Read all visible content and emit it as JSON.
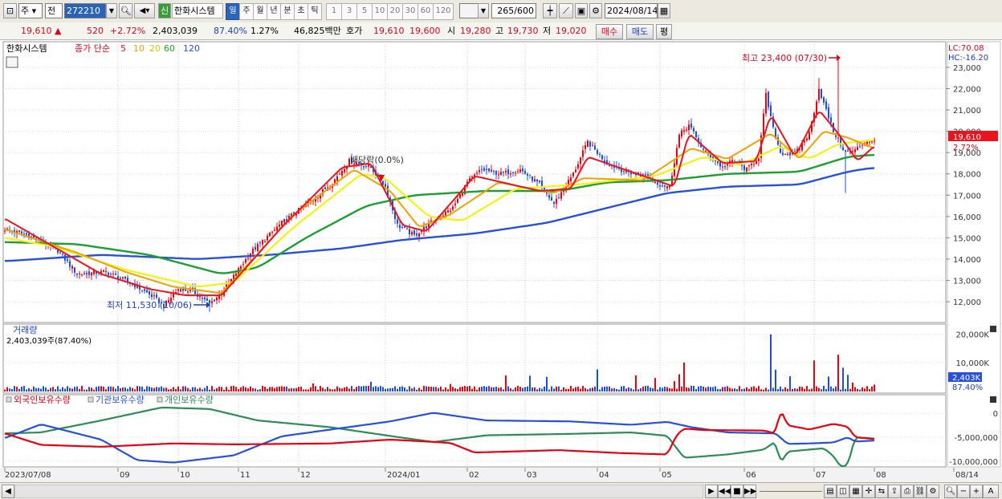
{
  "toolbar": {
    "market": "주",
    "prev": "전",
    "code": "272210",
    "shin_badge": "신",
    "stock_name": "한화시스템",
    "periods": [
      {
        "label": "일",
        "selected": true
      },
      {
        "label": "주",
        "selected": false
      },
      {
        "label": "월",
        "selected": false
      },
      {
        "label": "년",
        "selected": false
      },
      {
        "label": "분",
        "selected": false
      },
      {
        "label": "초",
        "selected": false
      },
      {
        "label": "틱",
        "selected": false
      },
      {
        "label": "1",
        "selected": false
      },
      {
        "label": "3",
        "selected": false
      },
      {
        "label": "5",
        "selected": false
      },
      {
        "label": "10",
        "selected": false
      },
      {
        "label": "20",
        "selected": false
      },
      {
        "label": "30",
        "selected": false
      },
      {
        "label": "60",
        "selected": false
      },
      {
        "label": "120",
        "selected": false
      }
    ],
    "count": "265",
    "count_total": "/600",
    "date": "2024/08/14"
  },
  "quote": {
    "price": "19,610",
    "change": "520",
    "change_pct": "+2.72%",
    "volume": "2,403,039",
    "vol_ratio": "87.40%",
    "turnover": "1.27%",
    "amount": "46,825백만",
    "hoga_label": "호가",
    "ask": "19,610",
    "bid": "19,600",
    "open_label": "시",
    "open": "19,280",
    "high_label": "고",
    "high": "19,730",
    "low_label": "저",
    "low": "19,020",
    "buy_btn": "매수",
    "sell_btn": "매도",
    "eval_btn": "평"
  },
  "legend": {
    "name": "한화시스템",
    "title": "종가 단순",
    "mas": [
      {
        "label": "5",
        "color": "#e8141e"
      },
      {
        "label": "10",
        "color": "#f0a000"
      },
      {
        "label": "20",
        "color": "#f2f214"
      },
      {
        "label": "60",
        "color": "#1e9e32"
      },
      {
        "label": "120",
        "color": "#2850d8"
      }
    ]
  },
  "colors": {
    "up": "#e60012",
    "down": "#1f4ed8",
    "ma5": "#e8141e",
    "ma10": "#f0a000",
    "ma20": "#f2f214",
    "ma60": "#1e9e32",
    "ma120": "#2850d8"
  },
  "annotations": {
    "high": "최고 23,400 (07/30)",
    "low": "최저 11,530 (10/06)",
    "dividend": "배당락(0.0%)"
  },
  "right_labels": {
    "lc": "LC:70.08",
    "hc": "HC:-16.20",
    "cur_price": "19,610",
    "cur_pct": "2.72%",
    "vol_now": "2,403K",
    "vol_pct": "87.40%"
  },
  "volume_panel": {
    "title": "거래량",
    "info": "2,403,039주(87.40%)"
  },
  "holdings_panel": {
    "legend": [
      "외국인보유수량",
      "기관보유수량",
      "개인보유수량"
    ],
    "colors": [
      "#e60012",
      "#2850d8",
      "#2e8b57"
    ]
  },
  "chart_data": {
    "type": "candlestick",
    "x_labels": [
      "2023/07/08",
      "09",
      "10",
      "11",
      "12",
      "2024/01",
      "02",
      "03",
      "04",
      "05",
      "06",
      "07",
      "08",
      "08/14"
    ],
    "price_axis": [
      12000,
      13000,
      14000,
      15000,
      16000,
      17000,
      18000,
      19000,
      20000,
      21000,
      22000,
      23000
    ],
    "price_axis_labels": [
      "12,000",
      "13,000",
      "14,000",
      "15,000",
      "16,000",
      "17,000",
      "18,000",
      "19,000",
      "20,000",
      "21,000",
      "22,000",
      "23,000"
    ],
    "price_range": [
      11100,
      23900
    ],
    "price_path": [
      [
        0,
        15400
      ],
      [
        10,
        15100
      ],
      [
        22,
        14400
      ],
      [
        30,
        13300
      ],
      [
        42,
        13400
      ],
      [
        52,
        12900
      ],
      [
        62,
        12200
      ],
      [
        66,
        11800
      ],
      [
        72,
        12600
      ],
      [
        78,
        12500
      ],
      [
        85,
        11900
      ],
      [
        90,
        12400
      ],
      [
        102,
        14300
      ],
      [
        115,
        15700
      ],
      [
        128,
        16800
      ],
      [
        136,
        17600
      ],
      [
        143,
        18600
      ],
      [
        152,
        18300
      ],
      [
        158,
        17400
      ],
      [
        163,
        15600
      ],
      [
        170,
        15100
      ],
      [
        178,
        15800
      ],
      [
        186,
        16400
      ],
      [
        192,
        17600
      ],
      [
        198,
        18200
      ],
      [
        206,
        18000
      ],
      [
        214,
        18200
      ],
      [
        222,
        17500
      ],
      [
        228,
        16600
      ],
      [
        236,
        18000
      ],
      [
        242,
        19500
      ],
      [
        250,
        18500
      ],
      [
        258,
        18100
      ],
      [
        266,
        17900
      ],
      [
        272,
        17500
      ],
      [
        276,
        17400
      ],
      [
        280,
        19800
      ],
      [
        284,
        20300
      ],
      [
        290,
        19100
      ],
      [
        298,
        18300
      ],
      [
        302,
        18600
      ],
      [
        308,
        18200
      ],
      [
        313,
        18800
      ],
      [
        316,
        21700
      ],
      [
        319,
        20100
      ],
      [
        322,
        19000
      ],
      [
        328,
        18900
      ],
      [
        334,
        19900
      ],
      [
        338,
        22000
      ],
      [
        340,
        21300
      ],
      [
        344,
        20000
      ],
      [
        349,
        19000
      ],
      [
        353,
        19100
      ],
      [
        357,
        19500
      ],
      [
        361,
        19610
      ]
    ],
    "ma5_path": [
      [
        0,
        15900
      ],
      [
        20,
        14600
      ],
      [
        40,
        13300
      ],
      [
        60,
        12600
      ],
      [
        75,
        12300
      ],
      [
        90,
        12300
      ],
      [
        115,
        15500
      ],
      [
        140,
        18300
      ],
      [
        152,
        18500
      ],
      [
        165,
        15600
      ],
      [
        175,
        15300
      ],
      [
        195,
        17900
      ],
      [
        222,
        17200
      ],
      [
        235,
        17300
      ],
      [
        242,
        18800
      ],
      [
        260,
        18100
      ],
      [
        278,
        17400
      ],
      [
        284,
        19900
      ],
      [
        298,
        18500
      ],
      [
        312,
        18600
      ],
      [
        318,
        20800
      ],
      [
        328,
        18800
      ],
      [
        338,
        21000
      ],
      [
        346,
        19900
      ],
      [
        354,
        18600
      ],
      [
        361,
        19300
      ]
    ],
    "ma10_path": [
      [
        0,
        15400
      ],
      [
        30,
        14300
      ],
      [
        50,
        13400
      ],
      [
        70,
        12700
      ],
      [
        90,
        12400
      ],
      [
        120,
        16100
      ],
      [
        145,
        18200
      ],
      [
        160,
        17200
      ],
      [
        172,
        15500
      ],
      [
        185,
        16100
      ],
      [
        205,
        17600
      ],
      [
        228,
        17100
      ],
      [
        240,
        17800
      ],
      [
        265,
        17700
      ],
      [
        285,
        19200
      ],
      [
        300,
        18700
      ],
      [
        318,
        19900
      ],
      [
        330,
        18700
      ],
      [
        340,
        20000
      ],
      [
        350,
        19700
      ],
      [
        361,
        19200
      ]
    ],
    "ma20_path": [
      [
        0,
        15000
      ],
      [
        20,
        14600
      ],
      [
        50,
        13500
      ],
      [
        80,
        12700
      ],
      [
        95,
        12900
      ],
      [
        120,
        15500
      ],
      [
        148,
        18000
      ],
      [
        158,
        17800
      ],
      [
        176,
        16000
      ],
      [
        190,
        15800
      ],
      [
        212,
        17300
      ],
      [
        238,
        17500
      ],
      [
        270,
        17900
      ],
      [
        290,
        18800
      ],
      [
        305,
        18400
      ],
      [
        322,
        19300
      ],
      [
        334,
        18700
      ],
      [
        346,
        19400
      ],
      [
        361,
        19600
      ]
    ],
    "ma60_path": [
      [
        0,
        14800
      ],
      [
        30,
        14700
      ],
      [
        60,
        14200
      ],
      [
        90,
        13300
      ],
      [
        105,
        13600
      ],
      [
        125,
        15000
      ],
      [
        150,
        16500
      ],
      [
        170,
        17000
      ],
      [
        200,
        17200
      ],
      [
        230,
        17200
      ],
      [
        250,
        17600
      ],
      [
        275,
        17700
      ],
      [
        300,
        18000
      ],
      [
        330,
        18100
      ],
      [
        350,
        18800
      ],
      [
        361,
        18900
      ]
    ],
    "ma120_path": [
      [
        0,
        13900
      ],
      [
        40,
        14200
      ],
      [
        80,
        14000
      ],
      [
        110,
        14200
      ],
      [
        140,
        14500
      ],
      [
        165,
        14900
      ],
      [
        195,
        15200
      ],
      [
        225,
        15700
      ],
      [
        250,
        16400
      ],
      [
        275,
        17100
      ],
      [
        300,
        17400
      ],
      [
        330,
        17500
      ],
      [
        350,
        18100
      ],
      [
        361,
        18300
      ]
    ],
    "volume_axis_labels": [
      "20,000K",
      "10,000K"
    ],
    "volume_range": [
      0,
      21500
    ],
    "volume_spikes": [
      [
        128,
        2800
      ],
      [
        152,
        3400
      ],
      [
        165,
        1800
      ],
      [
        178,
        1600
      ],
      [
        185,
        2600
      ],
      [
        208,
        5600
      ],
      [
        218,
        5500
      ],
      [
        225,
        5100
      ],
      [
        246,
        7700
      ],
      [
        262,
        5600
      ],
      [
        270,
        4700
      ],
      [
        278,
        3600
      ],
      [
        280,
        6000
      ],
      [
        282,
        10100
      ],
      [
        318,
        19900
      ],
      [
        320,
        7600
      ],
      [
        326,
        5300
      ],
      [
        336,
        10800
      ],
      [
        342,
        5200
      ],
      [
        346,
        12800
      ],
      [
        348,
        8300
      ],
      [
        350,
        5800
      ],
      [
        352,
        3100
      ],
      [
        361,
        2403
      ]
    ],
    "holdings_axis_labels": [
      "0",
      "-5,000,000",
      "-10,000,000"
    ],
    "holdings_range": [
      -11200000,
      2200000
    ],
    "foreign_path": [
      [
        0,
        -4200000
      ],
      [
        15,
        -6600000
      ],
      [
        40,
        -7000000
      ],
      [
        70,
        -6300000
      ],
      [
        95,
        -6500000
      ],
      [
        135,
        -6300000
      ],
      [
        160,
        -5500000
      ],
      [
        175,
        -5900000
      ],
      [
        185,
        -6200000
      ],
      [
        195,
        -8200000
      ],
      [
        230,
        -7700000
      ],
      [
        255,
        -8300000
      ],
      [
        275,
        -8600000
      ],
      [
        279,
        -4500000
      ],
      [
        282,
        -3200000
      ],
      [
        290,
        -3500000
      ],
      [
        315,
        -3600000
      ],
      [
        320,
        -4200000
      ],
      [
        322,
        900000
      ],
      [
        325,
        -2500000
      ],
      [
        334,
        -3400000
      ],
      [
        344,
        -2200000
      ],
      [
        350,
        -2800000
      ],
      [
        353,
        -5000000
      ],
      [
        361,
        -5300000
      ]
    ],
    "inst_path": [
      [
        0,
        -5200000
      ],
      [
        15,
        -2300000
      ],
      [
        40,
        -5500000
      ],
      [
        55,
        -9800000
      ],
      [
        70,
        -10300000
      ],
      [
        95,
        -8800000
      ],
      [
        115,
        -4800000
      ],
      [
        160,
        -1700000
      ],
      [
        178,
        100000
      ],
      [
        200,
        -1500000
      ],
      [
        235,
        -1700000
      ],
      [
        260,
        -2400000
      ],
      [
        275,
        -1800000
      ],
      [
        285,
        -2900000
      ],
      [
        300,
        -4000000
      ],
      [
        320,
        -4200000
      ],
      [
        325,
        -6400000
      ],
      [
        334,
        -6300000
      ],
      [
        344,
        -6100000
      ],
      [
        350,
        -5000000
      ],
      [
        353,
        -5900000
      ],
      [
        361,
        -5700000
      ]
    ],
    "indiv_path": [
      [
        0,
        -4200000
      ],
      [
        15,
        -4000000
      ],
      [
        40,
        -1500000
      ],
      [
        65,
        1200000
      ],
      [
        85,
        900000
      ],
      [
        105,
        -1500000
      ],
      [
        135,
        -2900000
      ],
      [
        165,
        -5100000
      ],
      [
        178,
        -6000000
      ],
      [
        200,
        -4600000
      ],
      [
        235,
        -4300000
      ],
      [
        260,
        -4000000
      ],
      [
        275,
        -4700000
      ],
      [
        282,
        -9300000
      ],
      [
        300,
        -8600000
      ],
      [
        315,
        -7600000
      ],
      [
        320,
        -5900000
      ],
      [
        322,
        -10500000
      ],
      [
        325,
        -8000000
      ],
      [
        340,
        -7300000
      ],
      [
        344,
        -8900000
      ],
      [
        347,
        -11200000
      ],
      [
        350,
        -10800000
      ],
      [
        353,
        -5000000
      ],
      [
        361,
        -5400000
      ]
    ]
  }
}
